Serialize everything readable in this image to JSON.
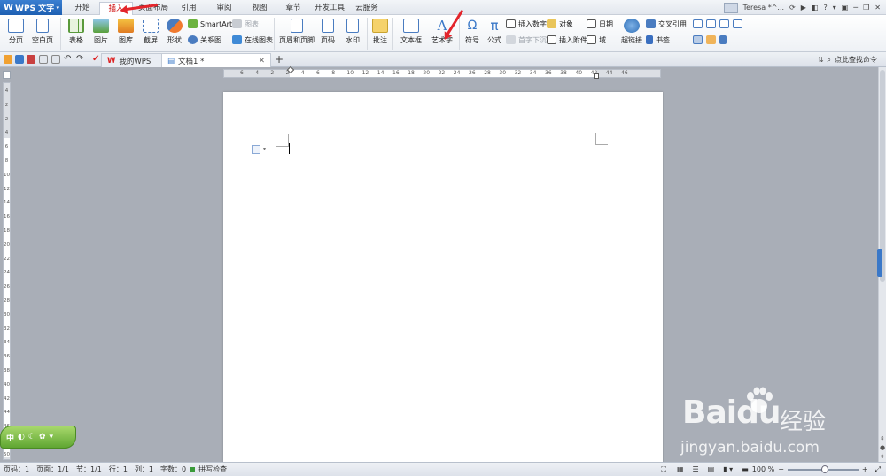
{
  "app": {
    "name": "WPS 文字",
    "logo": "W"
  },
  "tabs": [
    "开始",
    "插入",
    "页面布局",
    "引用",
    "审阅",
    "视图",
    "章节",
    "开发工具",
    "云服务"
  ],
  "active_tab": "插入",
  "user": {
    "name": "Teresa *^..."
  },
  "ribbon": {
    "page_break": "分页",
    "blank_page": "空白页",
    "table": "表格",
    "picture": "图片",
    "gallery": "图库",
    "screenshot": "截屏",
    "shape": "形状",
    "smartart": "SmartArt",
    "chart": "图表",
    "relation": "关系图",
    "online_chart": "在线图表",
    "header_footer": "页眉和页脚",
    "page_number": "页码",
    "watermark": "水印",
    "comment": "批注",
    "textbox": "文本框",
    "wordart": "艺术字",
    "symbol": "符号",
    "formula": "公式",
    "insert_number": "插入数字",
    "object": "对象",
    "date": "日期",
    "first_sink": "首字下沉",
    "attachment": "插入附件",
    "field": "域",
    "hyperlink": "超链接",
    "cross_ref": "交叉引用",
    "bookmark": "书签"
  },
  "doc_tabs": [
    {
      "label": "我的WPS",
      "active": false
    },
    {
      "label": "文档1 *",
      "active": true
    }
  ],
  "find_command": "点此查找命令",
  "ruler_h": [
    "6",
    "4",
    "2",
    "2",
    "4",
    "6",
    "8",
    "10",
    "12",
    "14",
    "16",
    "18",
    "20",
    "22",
    "24",
    "26",
    "28",
    "30",
    "32",
    "34",
    "36",
    "38",
    "40",
    "42",
    "44",
    "46"
  ],
  "ruler_v": [
    "4",
    "2",
    "2",
    "4",
    "6",
    "8",
    "10",
    "12",
    "14",
    "16",
    "18",
    "20",
    "22",
    "24",
    "26",
    "28",
    "30",
    "32",
    "34",
    "36",
    "38",
    "40",
    "42",
    "44",
    "46",
    "48",
    "50"
  ],
  "status": {
    "page_no": "页码：1",
    "page": "页面：1/1",
    "section": "节：1/1",
    "row": "行：1",
    "col": "列：1",
    "words": "字数：0",
    "spell": "拼写检查",
    "zoom": "100 %"
  },
  "ime": {
    "label": "中"
  },
  "watermark": {
    "brand": "Baidu",
    "cn": "经验",
    "url": "jingyan.baidu.com"
  },
  "colors": {
    "accent": "#1d5fb2",
    "arrow": "#e3252b",
    "ime": "#5fa632"
  }
}
